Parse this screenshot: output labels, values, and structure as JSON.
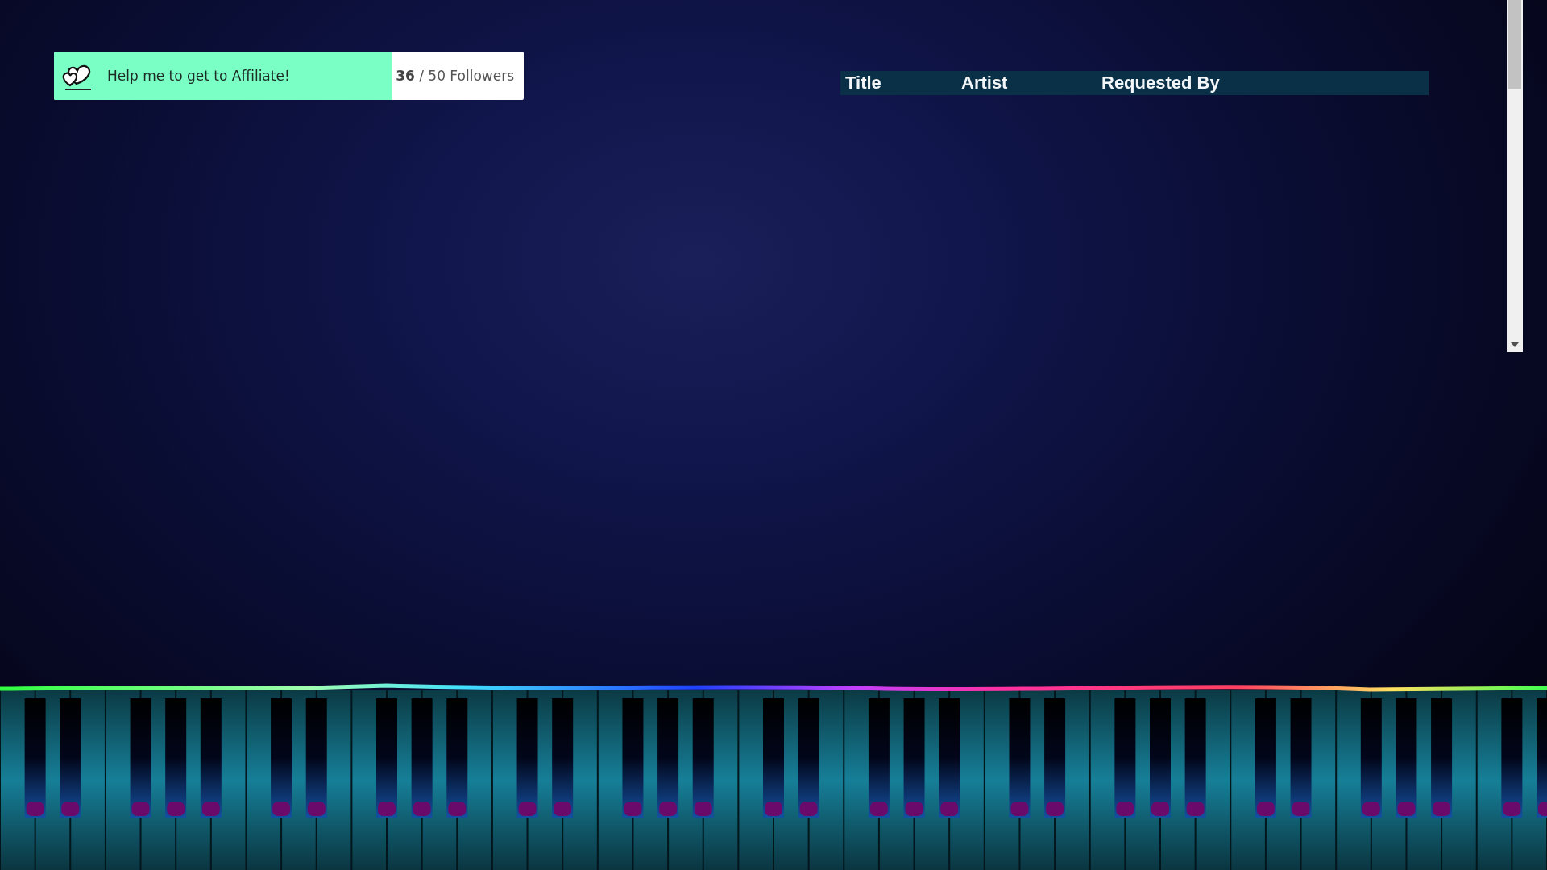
{
  "goal": {
    "label": "Help me to get to Affiliate!",
    "progress": "**36** / 50 Followers",
    "level": 0.72
  },
  "song_queue": {
    "columns": [
      "Title",
      "Artist",
      "Requested By"
    ]
  }
}
